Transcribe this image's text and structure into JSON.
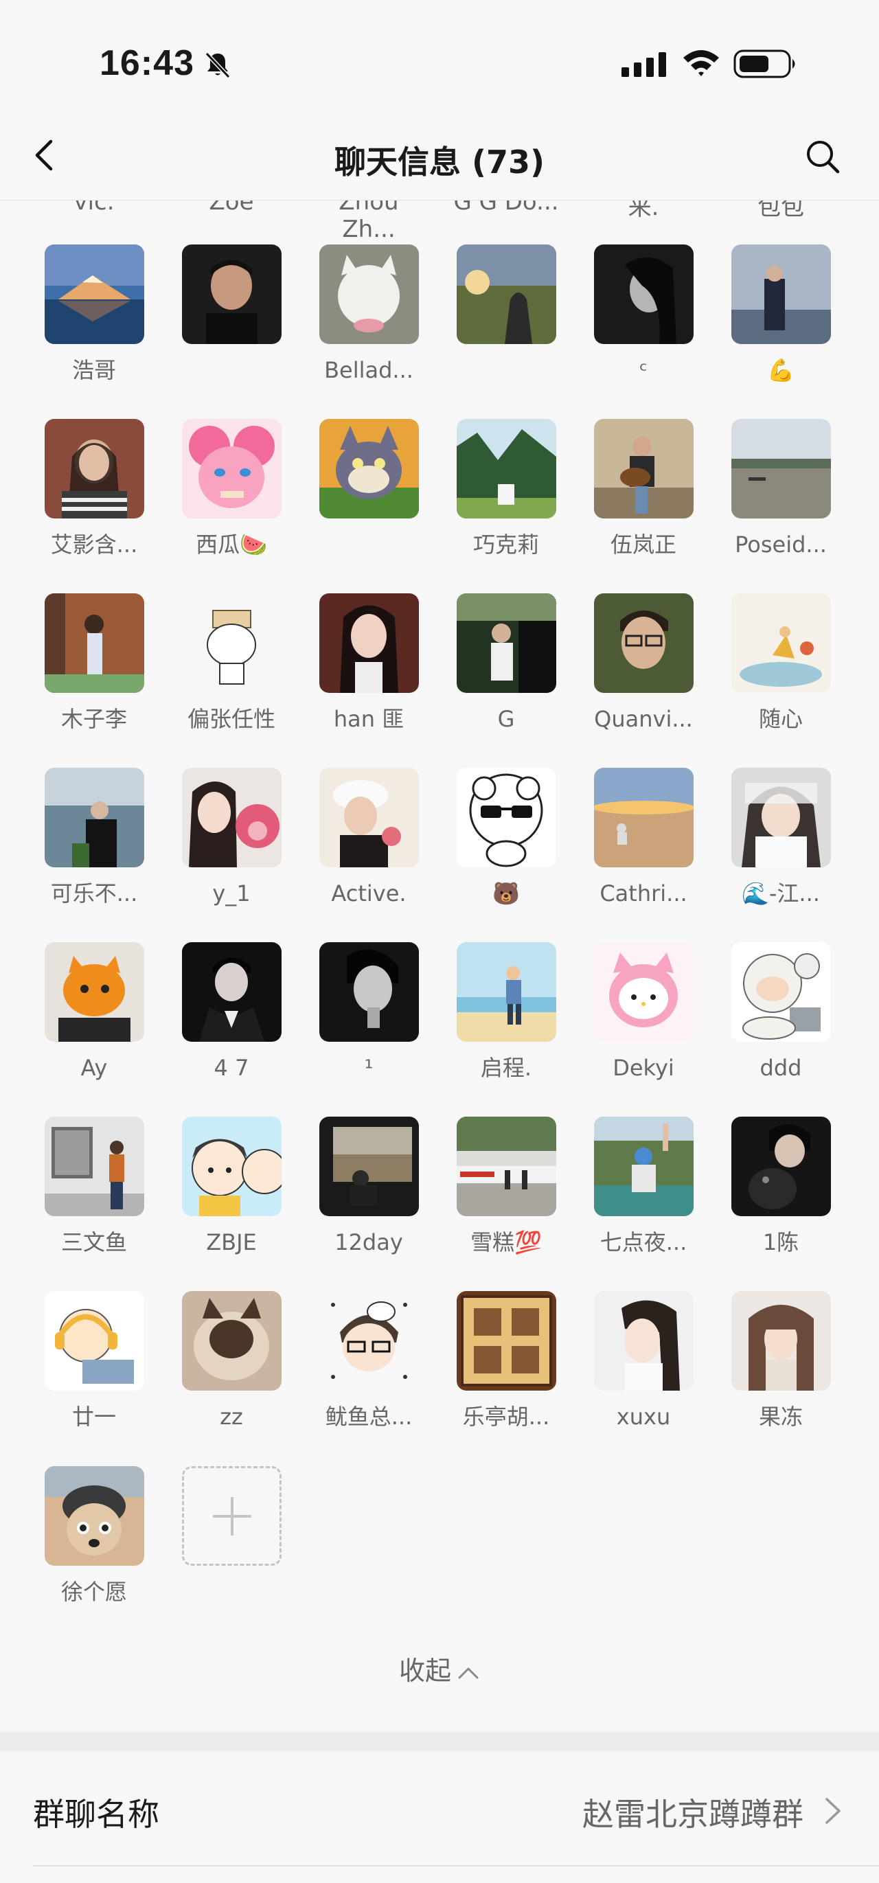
{
  "status_bar": {
    "time": "16:43",
    "icons": [
      "bell-mute-icon",
      "cellular-signal-icon",
      "wifi-icon",
      "battery-icon"
    ]
  },
  "header": {
    "title": "聊天信息 (73)",
    "back_icon": "chevron-left-icon",
    "search_icon": "search-icon"
  },
  "members": {
    "cut_off_labels": [
      "vic.",
      "Zoe",
      "Zhou Zh...",
      "G G Do...",
      "来.",
      "包包"
    ],
    "list": [
      {
        "name": "浩哥",
        "avatar": "avatar-mountain-lake"
      },
      {
        "name": "",
        "avatar": "avatar-boy-dark"
      },
      {
        "name": "Bellad...",
        "avatar": "avatar-white-cat"
      },
      {
        "name": "",
        "avatar": "avatar-sunset-field"
      },
      {
        "name": "ᶜ",
        "avatar": "avatar-bw-portrait"
      },
      {
        "name": "💪",
        "avatar": "avatar-man-seaside"
      },
      {
        "name": "艾影含...",
        "avatar": "avatar-girl-brick"
      },
      {
        "name": "西瓜🍉",
        "avatar": "avatar-pink-pony"
      },
      {
        "name": "",
        "avatar": "avatar-cartoon-cat"
      },
      {
        "name": "巧克莉",
        "avatar": "avatar-forest"
      },
      {
        "name": "伍岚正",
        "avatar": "avatar-guitar"
      },
      {
        "name": "Poseid...",
        "avatar": "avatar-river"
      },
      {
        "name": "木子李",
        "avatar": "avatar-girl-wall"
      },
      {
        "name": "偏张任性",
        "avatar": "avatar-doodle"
      },
      {
        "name": "han 匪",
        "avatar": "avatar-woman-dark"
      },
      {
        "name": "G",
        "avatar": "avatar-car-man"
      },
      {
        "name": "Quanvi...",
        "avatar": "avatar-man-glasses"
      },
      {
        "name": "随心",
        "avatar": "avatar-little-prince"
      },
      {
        "name": "可乐不...",
        "avatar": "avatar-lake-woman"
      },
      {
        "name": "y_1",
        "avatar": "avatar-girl-bear"
      },
      {
        "name": "Active.",
        "avatar": "avatar-hat-girl"
      },
      {
        "name": "🐻",
        "avatar": "avatar-sheep-sunglasses"
      },
      {
        "name": "Cathri...",
        "avatar": "avatar-desert"
      },
      {
        "name": "🌊-江...",
        "avatar": "avatar-veil-girl"
      },
      {
        "name": "Ay",
        "avatar": "avatar-orange-toy"
      },
      {
        "name": "4 7",
        "avatar": "avatar-man-suit"
      },
      {
        "name": "¹",
        "avatar": "avatar-bw-man"
      },
      {
        "name": "启程.",
        "avatar": "avatar-beach-cartoon"
      },
      {
        "name": "Dekyi",
        "avatar": "avatar-hello-kitty"
      },
      {
        "name": "ddd",
        "avatar": "avatar-sheep-laptop"
      },
      {
        "name": "三文鱼",
        "avatar": "avatar-gallery"
      },
      {
        "name": "ZBJE",
        "avatar": "avatar-cartoon-boys"
      },
      {
        "name": "12day",
        "avatar": "avatar-window-view"
      },
      {
        "name": "雪糕💯",
        "avatar": "avatar-plaza"
      },
      {
        "name": "七点夜...",
        "avatar": "avatar-waterfall"
      },
      {
        "name": "1陈",
        "avatar": "avatar-man-dog"
      },
      {
        "name": "廿一",
        "avatar": "avatar-headphone-cartoon"
      },
      {
        "name": "zz",
        "avatar": "avatar-siamese-cat"
      },
      {
        "name": "鱿鱼总...",
        "avatar": "avatar-dotted-cartoon"
      },
      {
        "name": "乐亭胡...",
        "avatar": "avatar-calligraphy"
      },
      {
        "name": "xuxu",
        "avatar": "avatar-girl-white"
      },
      {
        "name": "果冻",
        "avatar": "avatar-girl-bangs"
      },
      {
        "name": "徐个愿",
        "avatar": "avatar-pilot-cat"
      }
    ],
    "add_button_icon": "plus-icon",
    "collapse_label": "收起",
    "collapse_icon": "chevron-up-icon"
  },
  "settings": {
    "group_name_label": "群聊名称",
    "group_name_value": "赵雷北京蹲蹲群",
    "chevron_icon": "chevron-right-icon"
  },
  "colors": {
    "background": "#f7f7f7",
    "primary_text": "#1a1a1a",
    "secondary_text": "#666666",
    "divider": "#e2e2e2"
  }
}
